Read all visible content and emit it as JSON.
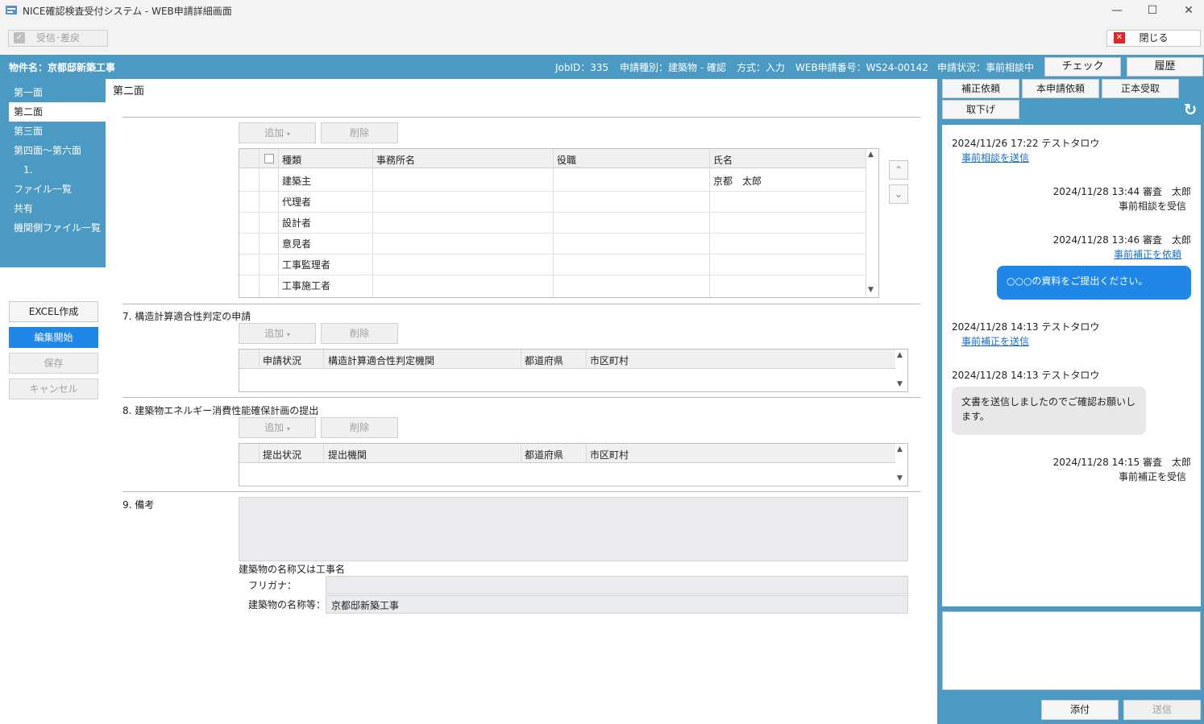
{
  "window": {
    "title": "NICE確認検査受付システム - WEB申請詳細画面",
    "minimize": "—",
    "maximize": "☐",
    "close": "✕"
  },
  "toolbar": {
    "receive_label": "受信･差戻",
    "close_label": "閉じる"
  },
  "header": {
    "property": "物件名：京都邸新築工事",
    "jobid": "JobID：335",
    "type": "申請種別：建築物 - 確認",
    "method": "方式：入力",
    "webno": "WEB申請番号：WS24-00142",
    "status": "申請状況：事前相談中",
    "check_label": "チェック",
    "history_label": "履歴"
  },
  "sidebar": {
    "items": [
      {
        "label": "第一面"
      },
      {
        "label": "第二面"
      },
      {
        "label": "第三面"
      },
      {
        "label": "第四面～第六面"
      },
      {
        "label": "1."
      },
      {
        "label": "ファイル一覧"
      },
      {
        "label": "共有"
      },
      {
        "label": "機関側ファイル一覧"
      }
    ]
  },
  "actions": {
    "excel": "EXCEL作成",
    "edit": "編集開始",
    "save": "保存",
    "cancel": "キャンセル"
  },
  "main": {
    "page_title": "第二面",
    "add_label": "追加",
    "delete_label": "削除",
    "persons": {
      "columns": [
        "種類",
        "事務所名",
        "役職",
        "氏名"
      ],
      "rows": [
        {
          "kind": "建築主",
          "office": "",
          "post": "",
          "name": "京都　太郎"
        },
        {
          "kind": "代理者",
          "office": "",
          "post": "",
          "name": ""
        },
        {
          "kind": "設計者",
          "office": "",
          "post": "",
          "name": ""
        },
        {
          "kind": "意見者",
          "office": "",
          "post": "",
          "name": ""
        },
        {
          "kind": "工事監理者",
          "office": "",
          "post": "",
          "name": ""
        },
        {
          "kind": "工事施工者",
          "office": "",
          "post": "",
          "name": ""
        }
      ]
    },
    "sec7": {
      "title": "7. 構造計算適合性判定の申請",
      "columns": [
        "申請状況",
        "構造計算適合性判定機関",
        "都道府県",
        "市区町村"
      ]
    },
    "sec8": {
      "title": "8. 建築物エネルギー消費性能確保計画の提出",
      "columns": [
        "提出状況",
        "提出機関",
        "都道府県",
        "市区町村"
      ]
    },
    "sec9": {
      "title": "9. 備考",
      "building_name_label": "建築物の名称又は工事名",
      "furigana_label": "フリガナ：",
      "name_label": "建築物の名称等：",
      "furigana_value": "",
      "name_value": "京都邸新築工事"
    }
  },
  "right": {
    "btn_correction": "補正依頼",
    "btn_main_request": "本申請依頼",
    "btn_original": "正本受取",
    "btn_withdraw": "取下げ",
    "messages": [
      {
        "meta": "2024/11/26 17:22  テストタロウ",
        "text": "事前相談を送信"
      },
      {
        "meta": "2024/11/28 13:44  審査　太郎",
        "text": "事前相談を受信"
      },
      {
        "meta": "2024/11/28 13:46  審査　太郎",
        "text": "事前補正を依頼"
      },
      {
        "meta": "",
        "text": "○○○の資料をご提出ください。"
      },
      {
        "meta": "2024/11/28 14:13  テストタロウ",
        "text": "事前補正を送信"
      },
      {
        "meta": "2024/11/28 14:13  テストタロウ",
        "text": "文書を送信しましたのでご確認お願いします。"
      },
      {
        "meta": "2024/11/28 14:15  審査　太郎",
        "text": "事前補正を受信"
      }
    ],
    "attach_label": "添付",
    "send_label": "送信",
    "message_input": ""
  }
}
